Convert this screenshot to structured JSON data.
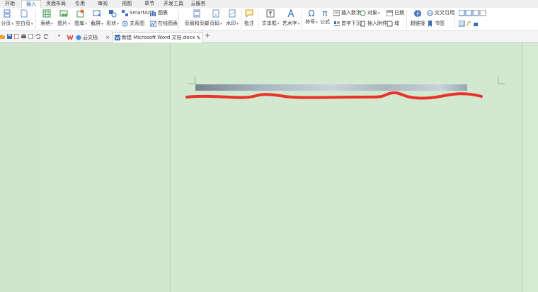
{
  "menu": {
    "tabs": [
      "开始",
      "插入",
      "页面布局",
      "引用",
      "审阅",
      "视图",
      "章节",
      "开发工具",
      "云服务"
    ],
    "active": "插入"
  },
  "ribbon": {
    "page_break": "分页",
    "blank_page": "空白页",
    "table": "表格",
    "picture": "图片",
    "gallery": "图库",
    "screenshot": "截屏",
    "shape": "形状",
    "smartart": "SmartArt",
    "chart": "图表",
    "relation": "关系图",
    "online_chart": "在线图表",
    "header_footer": "页眉和页脚",
    "page_number": "页码",
    "watermark": "水印",
    "comment": "批注",
    "textbox": "文本框",
    "wordart": "艺术字",
    "symbol": "符号",
    "formula": "公式",
    "insert_number": "插入数字",
    "object": "对象",
    "date": "日期",
    "drop_cap": "首字下沉",
    "attachment": "插入附件",
    "field": "域",
    "hyperlink": "超链接",
    "cross_ref": "交叉引用",
    "bookmark": "书签"
  },
  "tabs_row": {
    "cloud_doc": "云文档",
    "doc_tab": "新建 Microsoft Word 文档.docx *",
    "new_tab": "+"
  },
  "colors": {
    "page_bg": "#d2e9cf",
    "red_mark": "#e8322a",
    "active_tab_text": "#1f5fb5"
  }
}
